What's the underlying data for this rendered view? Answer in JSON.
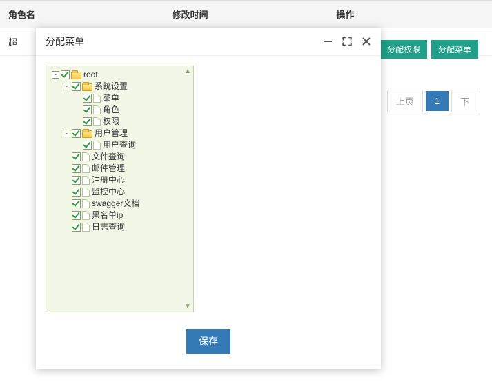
{
  "table": {
    "columns": [
      "角色名",
      "修改时间",
      "操作"
    ],
    "rowPrefix": "超"
  },
  "actions": {
    "perm": "分配权限",
    "menu": "分配菜单"
  },
  "pager": {
    "prev": "上页",
    "current": "1",
    "next": "下"
  },
  "modal": {
    "title": "分配菜单",
    "save": "保存"
  },
  "tree": [
    {
      "depth": 0,
      "toggle": "-",
      "checked": true,
      "icon": "folder",
      "label": "root"
    },
    {
      "depth": 1,
      "toggle": "-",
      "checked": true,
      "icon": "folder",
      "label": "系统设置"
    },
    {
      "depth": 2,
      "toggle": "",
      "checked": true,
      "icon": "file",
      "label": "菜单"
    },
    {
      "depth": 2,
      "toggle": "",
      "checked": true,
      "icon": "file",
      "label": "角色"
    },
    {
      "depth": 2,
      "toggle": "",
      "checked": true,
      "icon": "file",
      "label": "权限"
    },
    {
      "depth": 1,
      "toggle": "-",
      "checked": true,
      "icon": "folder",
      "label": "用户管理"
    },
    {
      "depth": 2,
      "toggle": "",
      "checked": true,
      "icon": "file",
      "label": "用户查询"
    },
    {
      "depth": 1,
      "toggle": "",
      "checked": true,
      "icon": "file",
      "label": "文件查询"
    },
    {
      "depth": 1,
      "toggle": "",
      "checked": true,
      "icon": "file",
      "label": "邮件管理"
    },
    {
      "depth": 1,
      "toggle": "",
      "checked": true,
      "icon": "file",
      "label": "注册中心"
    },
    {
      "depth": 1,
      "toggle": "",
      "checked": true,
      "icon": "file",
      "label": "监控中心"
    },
    {
      "depth": 1,
      "toggle": "",
      "checked": true,
      "icon": "file",
      "label": "swagger文档"
    },
    {
      "depth": 1,
      "toggle": "",
      "checked": true,
      "icon": "file",
      "label": "黑名单ip"
    },
    {
      "depth": 1,
      "toggle": "",
      "checked": true,
      "icon": "file",
      "label": "日志查询"
    }
  ]
}
